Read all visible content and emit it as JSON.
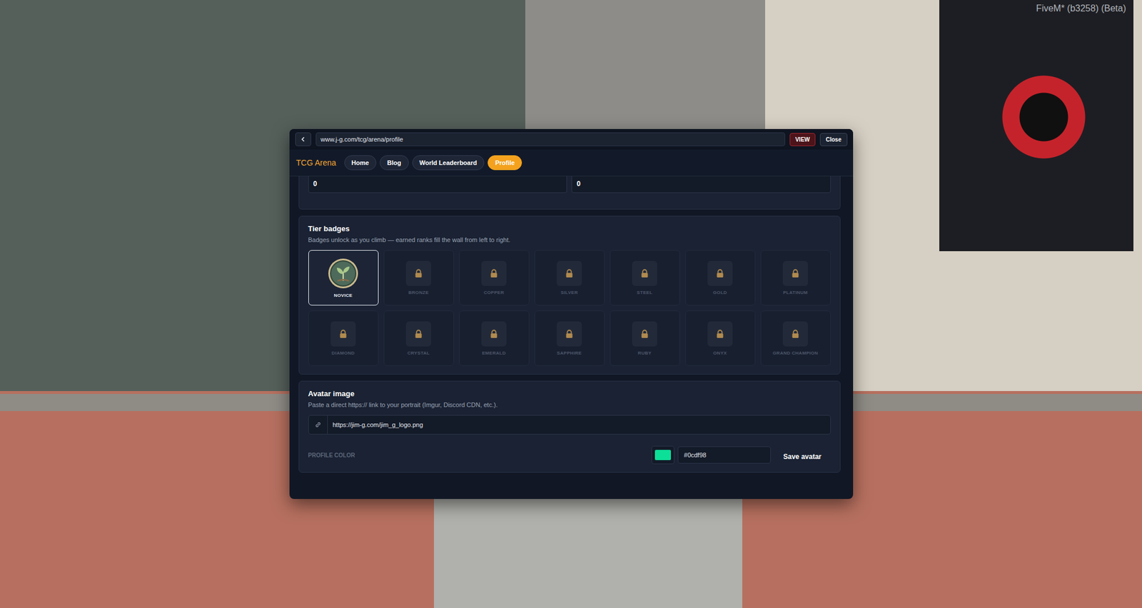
{
  "overlay": {
    "client_version": "FiveM* (b3258) (Beta)"
  },
  "browser": {
    "url": "www.j-g.com/tcg/arena/profile",
    "buttons": [
      "VIEW",
      "Close"
    ]
  },
  "site": {
    "brand": "TCG Arena",
    "tabs": [
      {
        "label": "Home",
        "selected": false
      },
      {
        "label": "Blog",
        "selected": false
      },
      {
        "label": "World Leaderboard",
        "selected": false
      },
      {
        "label": "Profile",
        "selected": true
      }
    ]
  },
  "stats_fields": [
    "0",
    "0"
  ],
  "tier_badges": {
    "title": "Tier badges",
    "subtitle": "Badges unlock as you climb — earned ranks fill the wall from left to right.",
    "badges": [
      {
        "name": "NOVICE",
        "unlocked": true
      },
      {
        "name": "BRONZE",
        "unlocked": false
      },
      {
        "name": "COPPER",
        "unlocked": false
      },
      {
        "name": "SILVER",
        "unlocked": false
      },
      {
        "name": "STEEL",
        "unlocked": false
      },
      {
        "name": "GOLD",
        "unlocked": false
      },
      {
        "name": "PLATINUM",
        "unlocked": false
      },
      {
        "name": "DIAMOND",
        "unlocked": false
      },
      {
        "name": "CRYSTAL",
        "unlocked": false
      },
      {
        "name": "EMERALD",
        "unlocked": false
      },
      {
        "name": "SAPPHIRE",
        "unlocked": false
      },
      {
        "name": "RUBY",
        "unlocked": false
      },
      {
        "name": "ONYX",
        "unlocked": false
      },
      {
        "name": "GRAND CHAMPION",
        "unlocked": false
      }
    ]
  },
  "avatar": {
    "title": "Avatar image",
    "hint": "Paste a direct https:// link to your portrait (Imgur, Discord CDN, etc.).",
    "url_value": "https://jim-g.com/jim_g_logo.png",
    "color_label": "PROFILE COLOR",
    "color_value": "#0cdf98",
    "color": "#0cdf98",
    "save_button": "Save avatar"
  }
}
